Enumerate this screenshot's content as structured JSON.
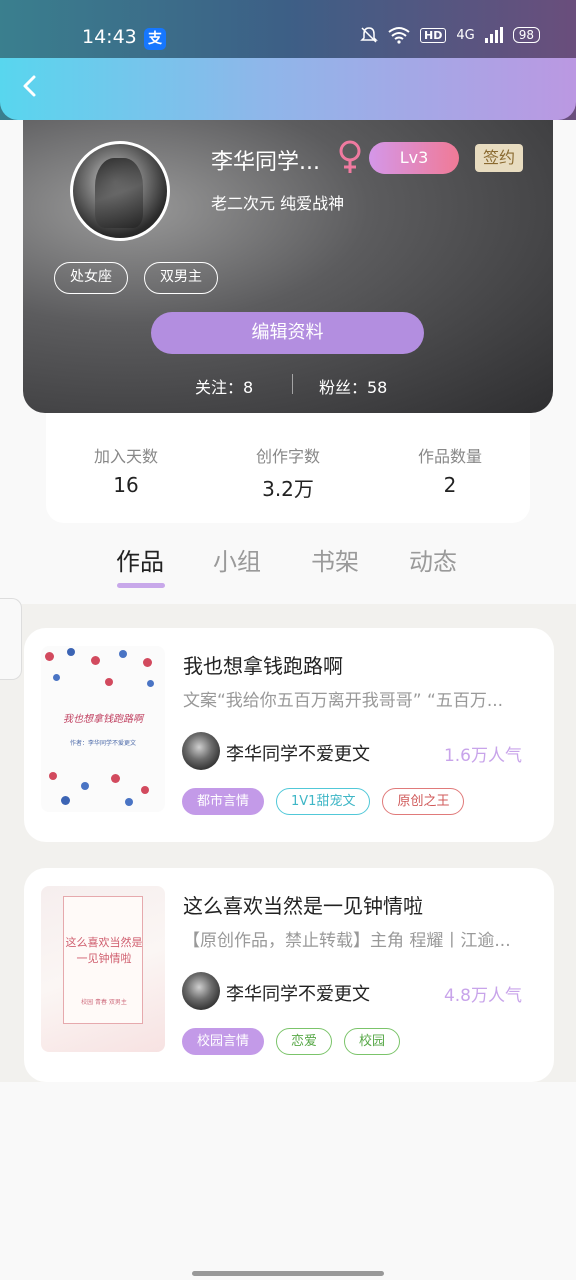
{
  "status_bar": {
    "time": "14:43",
    "app_icon_glyph": "支",
    "hd_label": "HD",
    "network_label": "4G",
    "battery": "98"
  },
  "profile": {
    "username": "李华同学...",
    "level": "Lv3",
    "sign_badge": "签约",
    "bio": "老二次元 纯爱战神",
    "tags": [
      "处女座",
      "双男主"
    ],
    "edit_button": "编辑资料",
    "following": "关注：8",
    "followers": "粉丝：58"
  },
  "stats": [
    {
      "label": "加入天数",
      "value": "16"
    },
    {
      "label": "创作字数",
      "value": "3.2万"
    },
    {
      "label": "作品数量",
      "value": "2"
    }
  ],
  "tabs": [
    "作品",
    "小组",
    "书架",
    "动态"
  ],
  "works": [
    {
      "title": "我也想拿钱跑路啊",
      "description": "文案“我给你五百万离开我哥哥” “五百万...",
      "author": "李华同学不爱更文",
      "popularity": "1.6万人气",
      "tags": [
        "都市言情",
        "1V1甜宠文",
        "原创之王"
      ],
      "cover_title": "我也想拿钱跑路啊",
      "cover_sub": "作者：李华同学不爱更文"
    },
    {
      "title": "这么喜欢当然是一见钟情啦",
      "description": "【原创作品，禁止转载】主角 程耀丨江逾...",
      "author": "李华同学不爱更文",
      "popularity": "4.8万人气",
      "tags": [
        "校园言情",
        "恋爱",
        "校园"
      ],
      "cover_title": "这么喜欢当然是一见钟情啦",
      "cover_sub": "校园 青春 双男主"
    }
  ],
  "colors": {
    "accent": "#b38ee0",
    "popularity": "#c8a4ea",
    "level_gradient_start": "#d497e9",
    "level_gradient_end": "#f07a96"
  }
}
